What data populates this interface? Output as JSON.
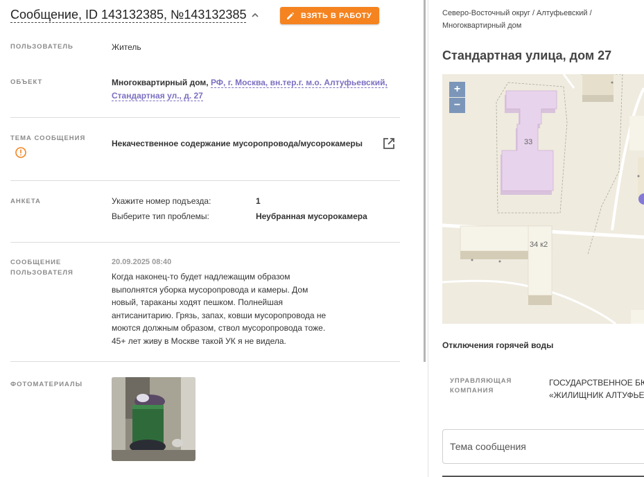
{
  "header": {
    "title": "Сообщение, ID 143132385, №143132385",
    "take_button": "ВЗЯТЬ В РАБОТУ"
  },
  "fields": {
    "user_label": "ПОЛЬЗОВАТЕЛЬ",
    "user_value": "Житель",
    "object_label": "ОБЪЕКТ",
    "object_type": "Многоквартирный дом,",
    "object_address_line1": "РФ, г. Москва, вн.тер.г. м.о. Алтуфьевский,",
    "object_address_line2": "Стандартная ул., д. 27",
    "topic_label": "ТЕМА СООБЩЕНИЯ",
    "topic_value": "Некачественное содержание мусоропровода/мусорокамеры",
    "survey_label": "АНКЕТА",
    "survey": [
      {
        "q": "Укажите номер подъезда:",
        "a": "1"
      },
      {
        "q": "Выберите тип проблемы:",
        "a": "Неубранная мусорокамера"
      }
    ],
    "message_label_1": "СООБЩЕНИЕ",
    "message_label_2": "ПОЛЬЗОВАТЕЛЯ",
    "message_date": "20.09.2025 08:40",
    "message_text": "Когда наконец-то будет надлежащим образом выполнятся уборка мусоропровода и камеры. Дом новый, тараканы ходят пешком. Полнейшая антисанитарию. Грязь, запах, ковши мусоропровода не моются должным образом, ствол мусоропровода тоже. 45+ лет живу в Москве такой УК я не видела.",
    "photos_label": "ФОТОМАТЕРИАЛЫ"
  },
  "sidebar": {
    "breadcrumb_line1": "Северо-Восточный округ / Алтуфьевский /",
    "breadcrumb_line2": "Многоквартирный дом",
    "address": "Стандартная улица, дом 27",
    "map": {
      "zoom_in": "+",
      "zoom_out": "−",
      "building_label_1": "33",
      "building_label_2": "34 к2"
    },
    "hot_water": "Отключения горячей воды",
    "manager_label_1": "УПРАВЛЯЮЩАЯ",
    "manager_label_2": "КОМПАНИЯ",
    "manager_value_1": "ГОСУДАРСТВЕННОЕ БЮ",
    "manager_value_2": "«ЖИЛИЩНИК АЛТУФЬЕ",
    "topic_placeholder": "Тема сообщения"
  },
  "colors": {
    "accent_orange": "#f5831f",
    "link_purple": "#7b6fc2",
    "warning_orange": "#f5831f",
    "building_pink": "#e8d3ec"
  }
}
